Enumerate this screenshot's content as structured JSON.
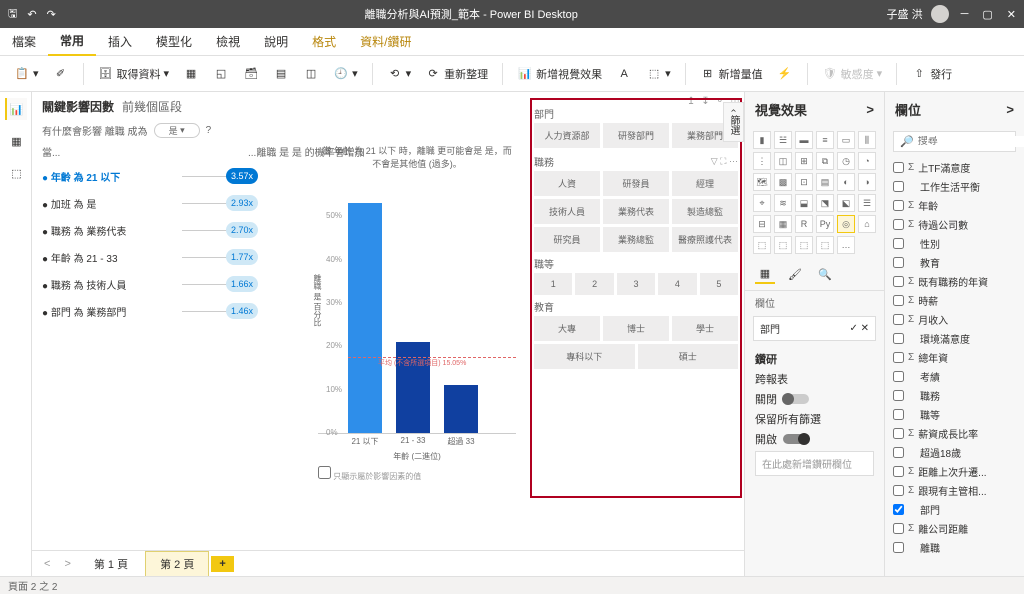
{
  "titlebar": {
    "title": "離職分析與AI預測_範本 - Power BI Desktop",
    "user": "子盛 洪"
  },
  "menu": {
    "file": "檔案",
    "home": "常用",
    "insert": "插入",
    "model": "模型化",
    "view": "檢視",
    "help": "說明",
    "format": "格式",
    "data": "資料/鑽研"
  },
  "ribbon": {
    "getdata": "取得資料",
    "refresh": "重新整理",
    "newvisual": "新增視覺效果",
    "newmeasure": "新增量值",
    "sensitivity": "敏感度",
    "publish": "發行"
  },
  "ki": {
    "title": "關鍵影響因數",
    "segments": "前幾個區段",
    "question_pre": "有什麼會影響 離職 成為",
    "question_val": "是",
    "question_suf": "?",
    "col1": "當...",
    "col2": "...離職 是 是 的機率會增加",
    "rows": [
      {
        "label": "年齡 為 21 以下",
        "val": "3.57x"
      },
      {
        "label": "加班 為 是",
        "val": "2.93x"
      },
      {
        "label": "職務 為 業務代表",
        "val": "2.70x"
      },
      {
        "label": "年齡 為 21 - 33",
        "val": "1.77x"
      },
      {
        "label": "職務 為 技術人員",
        "val": "1.66x"
      },
      {
        "label": "部門 為 業務部門",
        "val": "1.46x"
      }
    ]
  },
  "chart_data": {
    "type": "bar",
    "title": "當 年齡 為 21 以下 時，離職 更可能會是 是，而不會是其他值 (過多)。",
    "categories": [
      "21 以下",
      "21 - 33",
      "超過 33"
    ],
    "values": [
      53,
      21,
      11
    ],
    "ylabel": "離職 是 百分比",
    "xlabel": "年齡 (二進位)",
    "ylim": [
      0,
      60
    ],
    "yticks": [
      0,
      10,
      20,
      30,
      40,
      50
    ],
    "avg_label": "平均 (不含所選項目) 15.05%",
    "avg_value": 15.05,
    "checkbox": "只顯示屬於影響因素的值"
  },
  "slicers": {
    "s1": {
      "title": "部門",
      "items": [
        "人力資源部",
        "研發部門",
        "業務部門"
      ]
    },
    "s2": {
      "title": "職務",
      "items": [
        "人資",
        "研發員",
        "經理",
        "技術人員",
        "業務代表",
        "製造總監",
        "研究員",
        "業務總監",
        "醫療照護代表"
      ]
    },
    "s3": {
      "title": "職等",
      "items": [
        "1",
        "2",
        "3",
        "4",
        "5"
      ]
    },
    "s4": {
      "title": "教育",
      "items": [
        "大專",
        "博士",
        "學士",
        "專科以下",
        "碩士"
      ]
    }
  },
  "viz": {
    "title": "視覺效果",
    "well_label": "欄位",
    "well_value": "部門",
    "drill": "鑽研",
    "cross": "跨報表",
    "off": "關閉",
    "keep": "保留所有篩選",
    "on": "開啟",
    "placeholder": "在此處新增鑽研欄位"
  },
  "fields": {
    "title": "欄位",
    "search": "搜尋",
    "items": [
      {
        "l": "上TF滿意度",
        "s": true
      },
      {
        "l": "工作生活平衡",
        "s": false
      },
      {
        "l": "年齡",
        "s": true
      },
      {
        "l": "待過公司數",
        "s": true
      },
      {
        "l": "性別",
        "s": false
      },
      {
        "l": "教育",
        "s": false
      },
      {
        "l": "既有職務的年資",
        "s": true
      },
      {
        "l": "時薪",
        "s": true
      },
      {
        "l": "月收入",
        "s": true
      },
      {
        "l": "環境滿意度",
        "s": false
      },
      {
        "l": "總年資",
        "s": true
      },
      {
        "l": "考績",
        "s": false
      },
      {
        "l": "職務",
        "s": false
      },
      {
        "l": "職等",
        "s": false
      },
      {
        "l": "薪資成長比率",
        "s": true
      },
      {
        "l": "超過18歲",
        "s": false
      },
      {
        "l": "距離上次升遷...",
        "s": true
      },
      {
        "l": "跟現有主管相...",
        "s": true
      },
      {
        "l": "部門",
        "s": false,
        "c": true
      },
      {
        "l": "離公司距離",
        "s": true
      },
      {
        "l": "離職",
        "s": false
      }
    ]
  },
  "pages": {
    "p1": "第 1 頁",
    "p2": "第 2 頁"
  },
  "status": "頁面 2 之 2",
  "filters_tab": "篩選"
}
